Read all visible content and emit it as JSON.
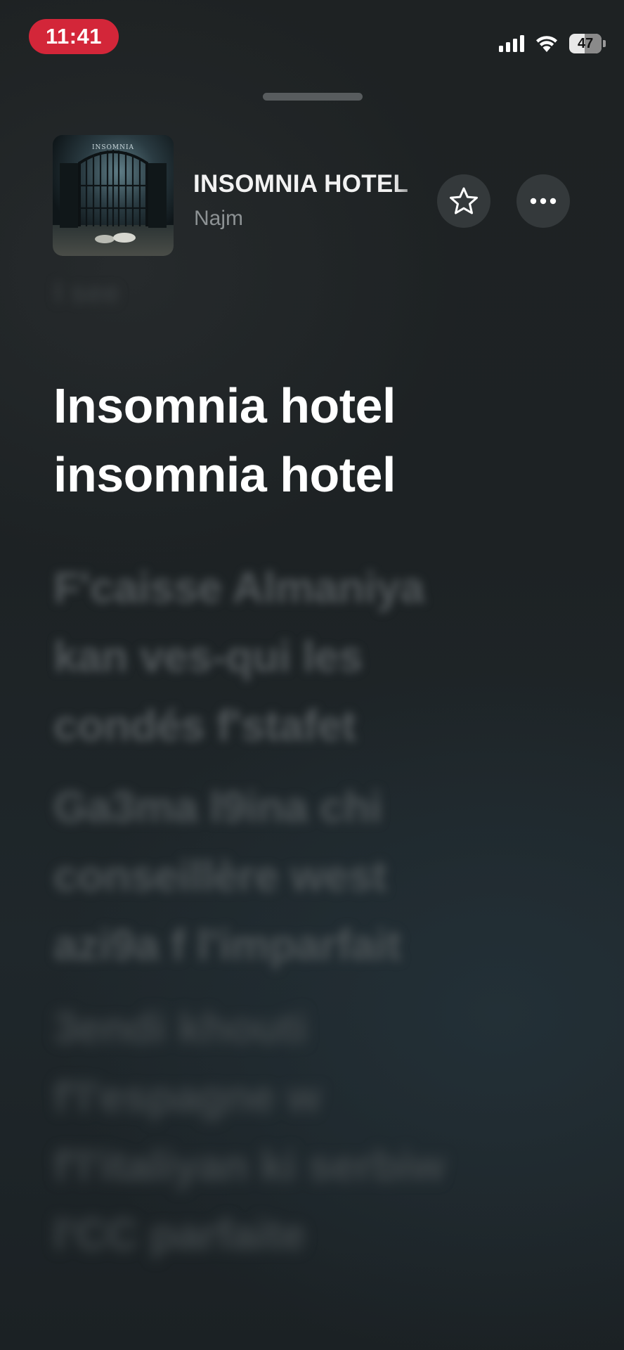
{
  "status_bar": {
    "time": "11:41",
    "battery_level": "47",
    "signal_icon": "cellular-signal-icon",
    "wifi_icon": "wifi-icon",
    "colors": {
      "time_pill": "#d32639"
    }
  },
  "now_playing": {
    "title": "INSOMNIA HOTEL",
    "artist": "Najm",
    "favorite_icon": "star-icon",
    "more_icon": "ellipsis-icon"
  },
  "lyrics": {
    "previous": "I see",
    "current": [
      "Insomnia hotel",
      "insomnia hotel"
    ],
    "upcoming": [
      [
        "F'caisse Almaniya",
        "kan ves-qui les",
        "condés f'stafet"
      ],
      [
        "Ga3ma l9ina chi",
        "conseillère west",
        "azi9a f l'imparfait"
      ],
      [
        "3endi khouti",
        "f'l'espagne w",
        "f'l'italiyan ki serbiw",
        "l'CC parfaite"
      ]
    ]
  }
}
